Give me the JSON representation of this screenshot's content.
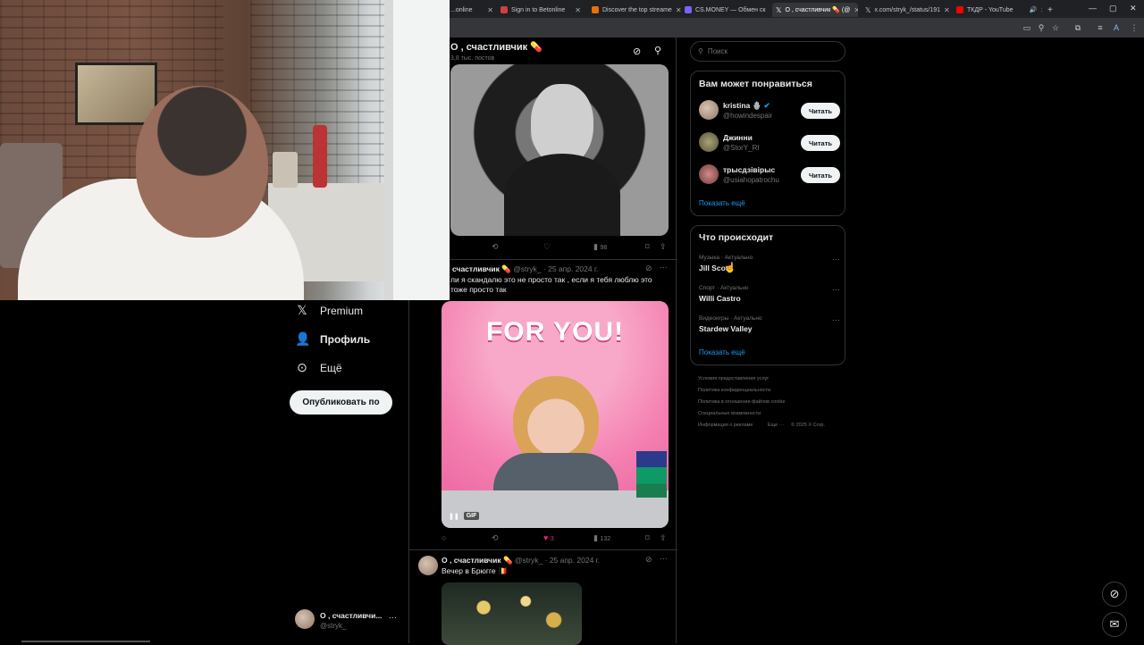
{
  "browser": {
    "tabs": [
      {
        "title": "...online",
        "color": "#8ab4f8"
      },
      {
        "title": "Sign in to Betonline",
        "color": "#d23f3f"
      },
      {
        "title": "Discover the top streame",
        "color": "#e8710a"
      },
      {
        "title": "CS.MONEY — Обмен ск",
        "color": "#7b61ff"
      },
      {
        "title": "О , счастливчик 💊 (@",
        "color": "#ffffff"
      },
      {
        "title": "x.com/stryk_/status/191",
        "color": "#ffffff"
      },
      {
        "title": "ТКДР - YouTube",
        "color": "#ff0000"
      }
    ],
    "new_tab": "+",
    "window_controls": [
      "—",
      "▢",
      "✕"
    ]
  },
  "profile_header": {
    "name": "О , счастливчик 💊",
    "posts_count": "3,8 тыс. постов"
  },
  "nav": {
    "items": [
      {
        "label": "Premium",
        "icon": "x-logo-icon"
      },
      {
        "label": "Профиль",
        "icon": "person-icon"
      },
      {
        "label": "Ещё",
        "icon": "more-circle-icon"
      }
    ],
    "post_button": "Опубликовать по",
    "account": {
      "name": "О , счастливчи...",
      "handle": "@stryk_"
    }
  },
  "posts": [
    {
      "stats": {
        "reply": "",
        "retweet": "",
        "like": "",
        "views": "98"
      }
    },
    {
      "name": "счастливчик 💊",
      "handle": "@stryk_",
      "date": "· 25 апр. 2024 г.",
      "text": "ли я скандалю это не просто так , если я тебя люблю это тоже просто так",
      "media_text": "FOR YOU!",
      "media_badge": "GIF",
      "stats": {
        "reply": "",
        "retweet": "",
        "like": "3",
        "views": "132"
      }
    },
    {
      "name": "О , счастливчик 💊",
      "handle": "@stryk_",
      "date": "· 25 апр. 2024 г.",
      "text": "Вечер в Брюгге 🇧🇪"
    }
  ],
  "search": {
    "placeholder": "Поиск"
  },
  "who_to_follow": {
    "title": "Вам может понравиться",
    "users": [
      {
        "name": "kristina 🪬",
        "handle": "@howindespair",
        "button": "Читать",
        "verified": true
      },
      {
        "name": "Джинни",
        "handle": "@StorY_RI",
        "button": "Читать",
        "verified": false
      },
      {
        "name": "трысдзівірыс",
        "handle": "@usiahopatrochu",
        "button": "Читать",
        "verified": false
      }
    ],
    "show_more": "Показать ещё"
  },
  "trends": {
    "title": "Что происходит",
    "items": [
      {
        "meta": "Музыка · Актуально",
        "name": "Jill Scott"
      },
      {
        "meta": "Спорт · Актуально",
        "name": "Willi Castro"
      },
      {
        "meta": "Видеоигры · Актуально",
        "name": "Stardew Valley"
      }
    ],
    "show_more": "Показать ещё"
  },
  "footer": {
    "links": [
      "Условия предоставления услуг",
      "Политика конфиденциальности",
      "Политика в отношении файлов cookie",
      "Специальные возможности",
      "Информация о рекламе",
      "Еще ···",
      "© 2025 X Corp."
    ]
  },
  "colors": {
    "accent": "#1d9bf0",
    "like": "#f91880",
    "background": "#000000",
    "border": "#2f3336"
  }
}
